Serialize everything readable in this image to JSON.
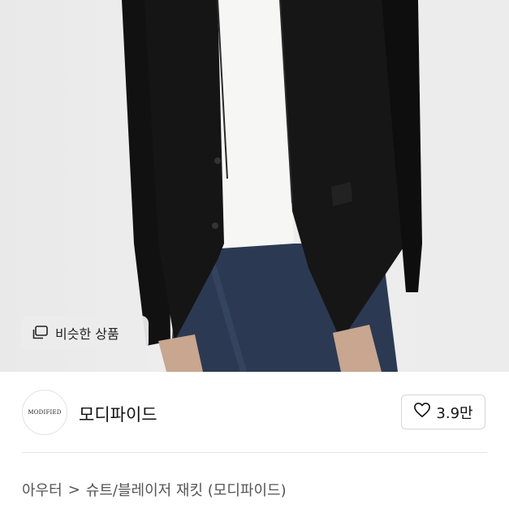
{
  "product_image": {
    "alt": ""
  },
  "similar_button": {
    "label": "비슷한 상품",
    "icon": "similar-items-icon"
  },
  "shop": {
    "logo_text": "MODIFIED",
    "name": "모디파이드",
    "like_count": "3.9만",
    "like_icon": "heart-icon"
  },
  "breadcrumb": {
    "category": "아우터",
    "separator": ">",
    "subcategory": "슈트/블레이저 재킷 (모디파이드)"
  }
}
